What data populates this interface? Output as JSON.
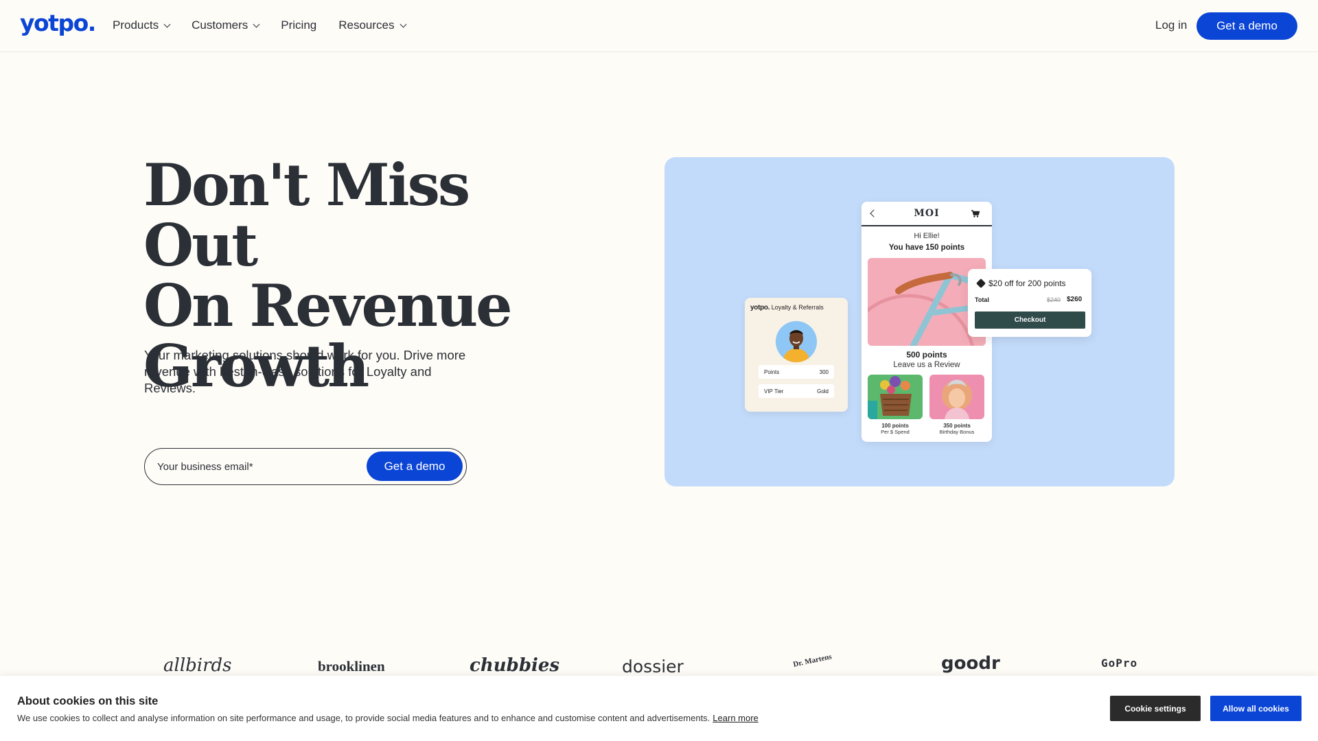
{
  "nav": {
    "logo": "yotpo.",
    "items": [
      {
        "label": "Products",
        "has_dropdown": true
      },
      {
        "label": "Customers",
        "has_dropdown": true
      },
      {
        "label": "Pricing",
        "has_dropdown": false
      },
      {
        "label": "Resources",
        "has_dropdown": true
      }
    ],
    "login": "Log in",
    "cta": "Get a demo"
  },
  "hero": {
    "title_line1": "Don't Miss Out",
    "title_line2": "On Revenue",
    "title_line3": "Growth",
    "subtitle": "Your marketing solutions should work for you. Drive more revenue with best-in-class solutions for Loyalty and Reviews.",
    "email_placeholder": "Your business email*",
    "cta": "Get a demo"
  },
  "illustration": {
    "background_color": "#c3dbfa",
    "loyalty_card": {
      "brand": "yotpo.",
      "brand_suffix": "Loyalty & Referrals",
      "rows": [
        {
          "label": "Points",
          "value": "300"
        },
        {
          "label": "VIP Tier",
          "value": "Gold"
        }
      ]
    },
    "phone": {
      "brand": "MOI",
      "greeting": "Hi Ellie!",
      "points_line": "You have 150 points",
      "hero_points": "500 points",
      "hero_action": "Leave us a Review",
      "thumbs": [
        {
          "points": "100 points",
          "caption": "Per $ Spend"
        },
        {
          "points": "350 points",
          "caption": "Birthday Bonus"
        }
      ]
    },
    "offer": {
      "title": "$20 off for 200 points",
      "total_label": "Total",
      "old_price": "$240",
      "new_price": "$260",
      "button": "Checkout"
    }
  },
  "logos": [
    "allbirds",
    "brooklinen",
    "chubbies",
    "dossier",
    "Dr. Martens",
    "goodr",
    "GoPro"
  ],
  "cookie": {
    "title": "About cookies on this site",
    "text": "We use cookies to collect and analyse information on site performance and usage, to provide social media features and to enhance and customise content and advertisements.",
    "learn_more": "Learn more",
    "settings_button": "Cookie settings",
    "allow_button": "Allow all cookies"
  },
  "colors": {
    "brand_blue": "#0b45d6",
    "text_dark": "#2b2f36",
    "page_bg": "#fefcf7",
    "checkout_green": "#2f4b4a"
  }
}
